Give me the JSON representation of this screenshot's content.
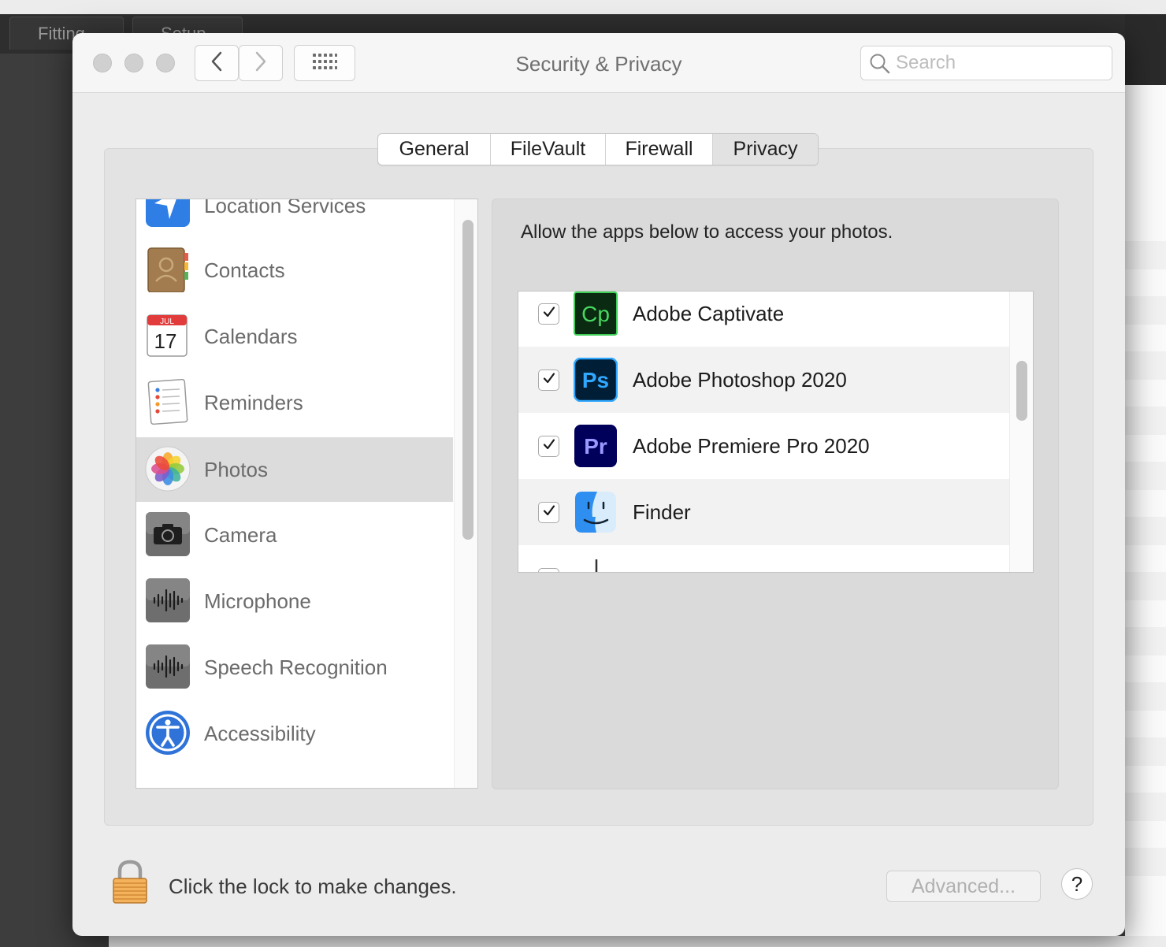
{
  "background_app": {
    "tabs": [
      "Fitting",
      "Setup"
    ]
  },
  "window": {
    "title": "Security & Privacy",
    "search": {
      "placeholder": "Search",
      "value": ""
    }
  },
  "tabs": [
    {
      "label": "General",
      "active": false
    },
    {
      "label": "FileVault",
      "active": false
    },
    {
      "label": "Firewall",
      "active": false
    },
    {
      "label": "Privacy",
      "active": true
    }
  ],
  "sidebar": {
    "items": [
      {
        "label": "Location Services",
        "icon": "location-services-icon"
      },
      {
        "label": "Contacts",
        "icon": "contacts-icon"
      },
      {
        "label": "Calendars",
        "icon": "calendar-icon",
        "icon_month": "JUL",
        "icon_day": "17"
      },
      {
        "label": "Reminders",
        "icon": "reminders-icon"
      },
      {
        "label": "Photos",
        "icon": "photos-icon",
        "selected": true
      },
      {
        "label": "Camera",
        "icon": "camera-icon"
      },
      {
        "label": "Microphone",
        "icon": "microphone-icon"
      },
      {
        "label": "Speech Recognition",
        "icon": "speech-recognition-icon"
      },
      {
        "label": "Accessibility",
        "icon": "accessibility-icon"
      }
    ]
  },
  "privacy": {
    "prompt": "Allow the apps below to access your photos.",
    "apps": [
      {
        "name": "Adobe Captivate",
        "checked": true,
        "icon": "adobe-captivate-icon",
        "icon_text": "Cp"
      },
      {
        "name": "Adobe Photoshop 2020",
        "checked": true,
        "icon": "adobe-photoshop-icon",
        "icon_text": "Ps"
      },
      {
        "name": "Adobe Premiere Pro 2020",
        "checked": true,
        "icon": "adobe-premiere-pro-icon",
        "icon_text": "Pr"
      },
      {
        "name": "Finder",
        "checked": true,
        "icon": "finder-icon"
      }
    ]
  },
  "footer": {
    "lock_text": "Click the lock to make changes.",
    "advanced_label": "Advanced...",
    "help_label": "?"
  },
  "colors": {
    "captivate": "#1d6b28",
    "photoshop": "#31a8ff",
    "premiere": "#9999ff",
    "selected_row": "#dcdcdc"
  }
}
